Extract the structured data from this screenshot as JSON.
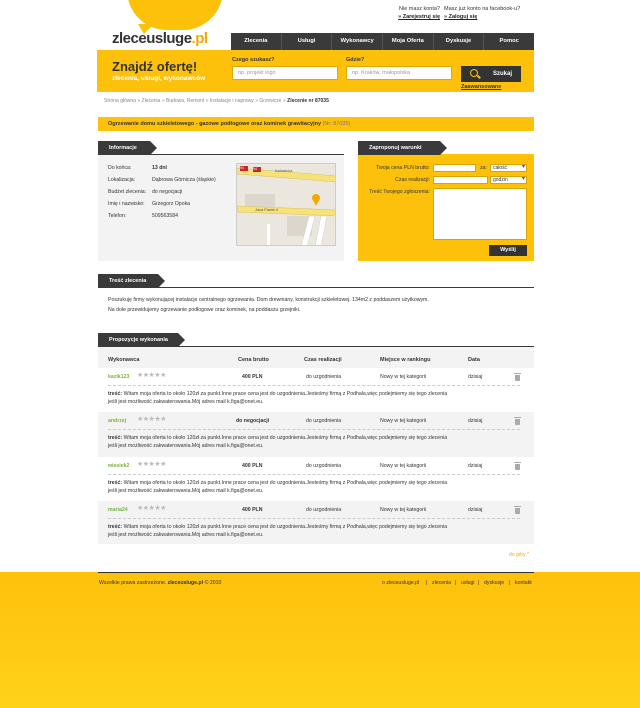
{
  "header": {
    "logo_main": "zleceusluge",
    "logo_tld": ".pl",
    "no_account": "Nie masz konta?",
    "register": "Zarejestruj się",
    "fb_question": "Masz już konto na facebook-u?",
    "login": "Zaloguj się"
  },
  "nav": {
    "items": [
      "Zlecenia",
      "Usługi",
      "Wykonawcy",
      "Moja Oferta",
      "Dyskusje",
      "Pomoc"
    ]
  },
  "search": {
    "title": "Znajdź ofertę!",
    "subtitle": "zlecenia, usługi, wykonawców",
    "what_label": "Czego szukasz?",
    "what_placeholder": "np. projekt logo",
    "where_label": "Gdzie?",
    "where_placeholder": "np. Kraków, małopolska",
    "button": "Szukaj",
    "advanced": "Zaawansowane"
  },
  "breadcrumb": {
    "path": "Strona główna » Zlecenia » Budowa, Remont » Instalacje i naprawy » Grzewcze » ",
    "current": "Zlecenie nr 87035"
  },
  "order": {
    "title": "Ogrzewanie domu szkieletowego - gazowe podłogowe oraz kominek grawitacyjny",
    "number": "(Nr: 87035)"
  },
  "info": {
    "tab": "Informacje",
    "rows": [
      {
        "label": "Do końca:",
        "value": "13 dni"
      },
      {
        "label": "Lokalizacja:",
        "value": "Dąbrowa Górnicza (śląskie)"
      },
      {
        "label": "Budżet zlecenia:",
        "value": "do negocjacji"
      },
      {
        "label": "Imię i nazwisko:",
        "value": "Grzegorz Opoka"
      },
      {
        "label": "Telefon:",
        "value": "509563584"
      }
    ],
    "map_labels": {
      "street1": "Katowicka",
      "street2": "Jana Pawła II",
      "road1": "94",
      "road2": "94"
    }
  },
  "offer": {
    "tab": "Zaproponuj warunki",
    "price_label": "Twoja cena PLN brutto:",
    "za": "za:",
    "price_unit": "całość",
    "time_label": "Czas realizacji:",
    "time_unit": "godzin",
    "message_label": "Treść Twojego zgłoszenia:",
    "send": "Wyślij"
  },
  "description": {
    "tab": "Treść zlecenia",
    "line1": "Poszukuję firmy wykonującej instalacje centralnego ogrzewania. Dom drewniany, konstrukcji szkieletowej. 134m2 z poddaszem użytkowym.",
    "line2": "Na dole przewidujemy ogrzewanie podłogowe oraz kominek, na poddaszu grzejniki."
  },
  "proposals": {
    "tab": "Propozycje wykonania",
    "headers": [
      "Wykonawca",
      "Cena brutto",
      "Czas realizacji",
      "Miejsce w rankingu",
      "Data"
    ],
    "comment_label": "treść:",
    "items": [
      {
        "user": "kazik123",
        "price": "400 PLN",
        "time": "do uzgodnienia",
        "rank": "Nowy w tej kategorii",
        "date": "dzisiaj",
        "comment1": "Witam moja oferta to około 120zł za punkt.Inne prace cena jest do uzgodnienia.Jesteśmy firmą z Podhala,więc podejmiemy się tego zlecenia",
        "comment2": "jeśli jest możliwość zakwaterowania.Mój adres mail k.figa@onet.eu."
      },
      {
        "user": "andrzej",
        "price": "do negocjacji",
        "time": "do uzgodnienia",
        "rank": "Nowy w tej kategorii",
        "date": "dzisiaj",
        "comment1": "Witam moja oferta to około 120zł za punkt.Inne prace cena jest do uzgodnienia.Jesteśmy firmą z Podhala,więc podejmiemy się tego zlecenia",
        "comment2": "jeśli jest możliwość zakwaterowania.Mój adres mail k.figa@onet.eu."
      },
      {
        "user": "wiesiek2",
        "price": "400 PLN",
        "time": "do uzgodnienia",
        "rank": "Nowy w tej kategorii",
        "date": "dzisiaj",
        "comment1": "Witam moja oferta to około 120zł za punkt.Inne prace cena jest do uzgodnienia.Jesteśmy firmą z Podhala,więc podejmiemy się tego zlecenia",
        "comment2": "jeśli jest możliwość zakwaterowania.Mój adres mail k.figa@onet.eu."
      },
      {
        "user": "maria24",
        "price": "400 PLN",
        "time": "do uzgodnienia",
        "rank": "Nowy w tej kategorii",
        "date": "dzisiaj",
        "comment1": "Witam moja oferta to około 120zł za punkt.Inne prace cena jest do uzgodnienia.Jesteśmy firmą z Podhala,więc podejmiemy się tego zlecenia",
        "comment2": "jeśli jest możliwość zakwaterowania.Mój adres mail k.figa@onet.eu."
      }
    ],
    "to_top": "do góry ^"
  },
  "footer": {
    "rights": "Wszelkie prawa zastrzeżone.",
    "brand": "zleceusluge.pl",
    "year": "© 2010",
    "links": [
      "o zleceusluge.pl",
      "zlecenia",
      "usługi",
      "dyskusje",
      "kontakt"
    ]
  },
  "colors": {
    "accent": "#fec10b",
    "dark": "#3a3a3a",
    "username": "#7cb342"
  }
}
